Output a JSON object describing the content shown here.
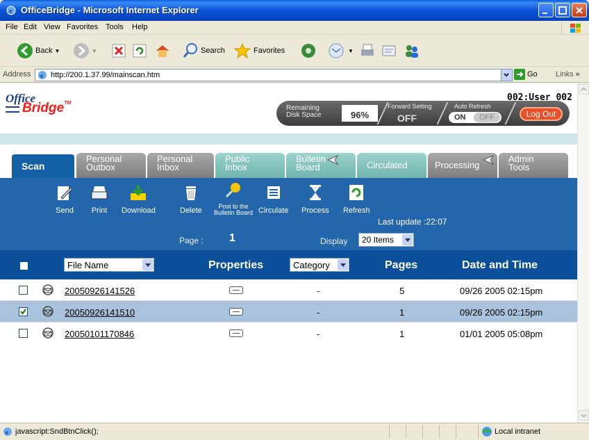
{
  "window": {
    "title": "OfficeBridge - Microsoft Internet Explorer"
  },
  "menu": [
    "File",
    "Edit",
    "View",
    "Favorites",
    "Tools",
    "Help"
  ],
  "toolbar": {
    "back": "Back",
    "search": "Search",
    "favorites": "Favorites"
  },
  "address": {
    "label": "Address",
    "url": "http://200.1.37.99/mainscan.htm",
    "go": "Go",
    "links": "Links"
  },
  "app": {
    "logo_top": "Office",
    "logo_bottom": "Bridge",
    "logo_tm": "TM",
    "user": "002:User 002",
    "remaining_label_1": "Remaining",
    "remaining_label_2": "Disk Space",
    "remaining_value": "96%",
    "forward_label": "Forward Setting",
    "forward_value": "OFF",
    "auto_refresh_label": "Auto Refresh",
    "auto_on": "ON",
    "auto_off": "OFF",
    "logout": "Log Out"
  },
  "tabs": [
    {
      "l1": "Scan",
      "l2": ""
    },
    {
      "l1": "Personal",
      "l2": "Outbox"
    },
    {
      "l1": "Personal",
      "l2": "Inbox"
    },
    {
      "l1": "Public",
      "l2": "Inbox"
    },
    {
      "l1": "Bulletin",
      "l2": "Board"
    },
    {
      "l1": "Circulated",
      "l2": ""
    },
    {
      "l1": "Processing",
      "l2": ""
    },
    {
      "l1": "Admin",
      "l2": "Tools"
    }
  ],
  "actions": {
    "send": "Send",
    "print": "Print",
    "download": "Download",
    "delete": "Delete",
    "post1": "Post to the",
    "post2": "Bulletin Board",
    "circulate": "Circulate",
    "process": "Process",
    "refresh": "Refresh",
    "last_update": "Last update :22:07"
  },
  "paging": {
    "page_label": "Page :",
    "page_value": "1",
    "display_label": "Display",
    "display_value": "20 Items"
  },
  "table": {
    "filename_select": "File Name",
    "properties": "Properties",
    "category_select": "Category",
    "pages": "Pages",
    "datetime": "Date and Time",
    "rows": [
      {
        "file": "20050926141526",
        "category": "-",
        "pages": "5",
        "date": "09/26 2005 02:15pm",
        "checked": false
      },
      {
        "file": "20050926141510",
        "category": "-",
        "pages": "1",
        "date": "09/26 2005 02:15pm",
        "checked": true
      },
      {
        "file": "20050101170846",
        "category": "-",
        "pages": "1",
        "date": "01/01 2005 05:08pm",
        "checked": false
      }
    ]
  },
  "status": {
    "text": "javascript:SndBtnClick();",
    "zone": "Local intranet"
  }
}
